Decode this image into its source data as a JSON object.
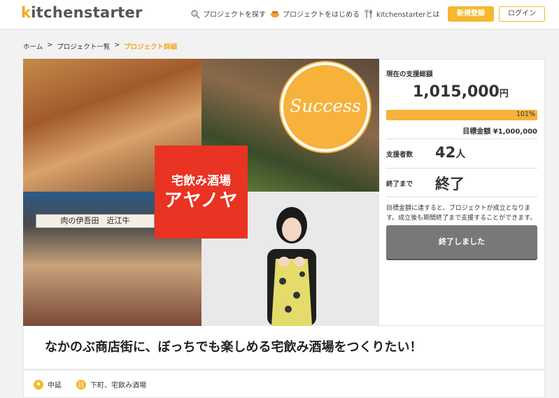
{
  "header": {
    "logo_prefix": "k",
    "logo_rest": "itchenstarter",
    "nav": [
      {
        "label": "プロジェクトを探す",
        "icon": "search-icon"
      },
      {
        "label": "プロジェクトをはじめる",
        "icon": "pot-icon"
      },
      {
        "label": "kitchenstarterとは",
        "icon": "utensils-icon"
      }
    ],
    "register_label": "新規登録",
    "login_label": "ログイン"
  },
  "breadcrumb": {
    "home": "ホーム",
    "sep": ">",
    "list": "プロジェクト一覧",
    "current": "プロジェクト詳細"
  },
  "hero": {
    "logo_line1": "宅飲み酒場",
    "logo_line2": "アヤノヤ",
    "success_text": "Success",
    "shop_sign": "肉の伊吾田　近江牛"
  },
  "stats": {
    "total_label": "現在の支援総額",
    "total_amount": "1,015,000",
    "total_unit": "円",
    "progress_percent": 101,
    "progress_label": "101%",
    "goal_text": "目標金額 ¥1,000,000",
    "supporters_label": "支援者数",
    "supporters_value": "42",
    "supporters_unit": "人",
    "remaining_label": "終了まで",
    "remaining_value": "終了",
    "note": "目標金額に達すると、プロジェクトが成立となります。成立後も期間終了まで支援することができます。",
    "ended_button": "終了しました"
  },
  "project": {
    "title": "なかのぶ商店街に、ぼっちでも楽しめる宅飲み酒場をつくりたい！",
    "tags": [
      {
        "label": "中延",
        "icon": "location-pin-icon"
      },
      {
        "label": "下町、宅飲み酒場",
        "icon": "fork-knife-icon"
      }
    ]
  },
  "colors": {
    "accent": "#f5b82e",
    "red": "#e93323",
    "ended_gray": "#787878"
  }
}
